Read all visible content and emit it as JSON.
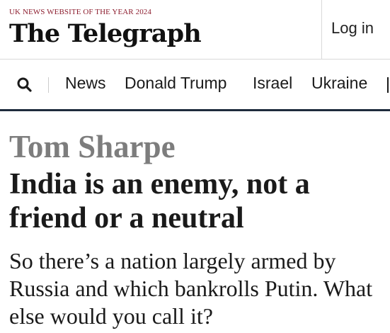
{
  "header": {
    "award_text": "UK NEWS WEBSITE OF THE YEAR 2024",
    "logo_text": "The Telegraph",
    "login_label": "Log in"
  },
  "nav": {
    "search_icon": "search-icon",
    "items": [
      {
        "label": "News"
      },
      {
        "label": "Donald Trump"
      },
      {
        "label": "Israel"
      },
      {
        "label": "Ukraine"
      }
    ]
  },
  "article": {
    "author": "Tom Sharpe",
    "headline": "India is an enemy, not a friend or a neutral",
    "standfirst": "So there’s a nation largely armed by Russia and which bankrolls Putin. What else would you call it?"
  },
  "colors": {
    "award": "#8c1d2e",
    "author": "#7d7d7d",
    "nav_border": "#1e2b3c"
  }
}
